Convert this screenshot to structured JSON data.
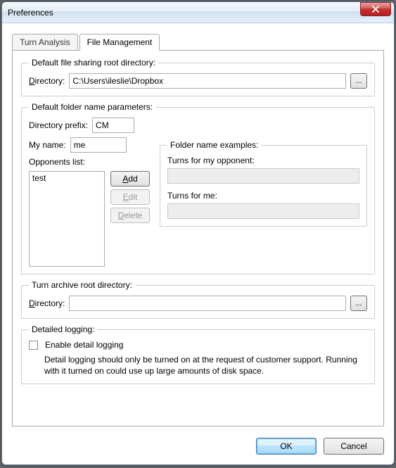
{
  "window": {
    "title": "Preferences"
  },
  "tabs": {
    "turn_analysis": "Turn Analysis",
    "file_management": "File Management"
  },
  "sharing": {
    "legend": "Default file sharing root directory:",
    "dir_label_pre": "D",
    "dir_label_post": "irectory:",
    "dir_value": "C:\\Users\\ileslie\\Dropbox",
    "browse": "..."
  },
  "params": {
    "legend": "Default folder name parameters:",
    "prefix_label": "Directory prefix:",
    "prefix_value": "CM",
    "myname_label": "My name:",
    "myname_value": "me",
    "opponents_label": "Opponents list:",
    "opponents_first": "test",
    "btn_add_pre": "A",
    "btn_add_post": "dd",
    "btn_edit_pre": "E",
    "btn_edit_post": "dit",
    "btn_delete_pre": "D",
    "btn_delete_post": "elete",
    "examples_legend": "Folder name examples:",
    "example_opponent_label": "Turns for my opponent:",
    "example_opponent_value": "",
    "example_me_label": "Turns for me:",
    "example_me_value": ""
  },
  "archive": {
    "legend": "Turn archive root directory:",
    "dir_label_pre": "D",
    "dir_label_post": "irectory:",
    "dir_value": "",
    "browse": "..."
  },
  "logging": {
    "legend": "Detailed logging:",
    "checkbox_label": "Enable detail logging",
    "help": "Detail logging should only be turned on at the request of customer support. Running with it turned on could use up large amounts of disk space."
  },
  "buttons": {
    "ok": "OK",
    "cancel": "Cancel"
  }
}
